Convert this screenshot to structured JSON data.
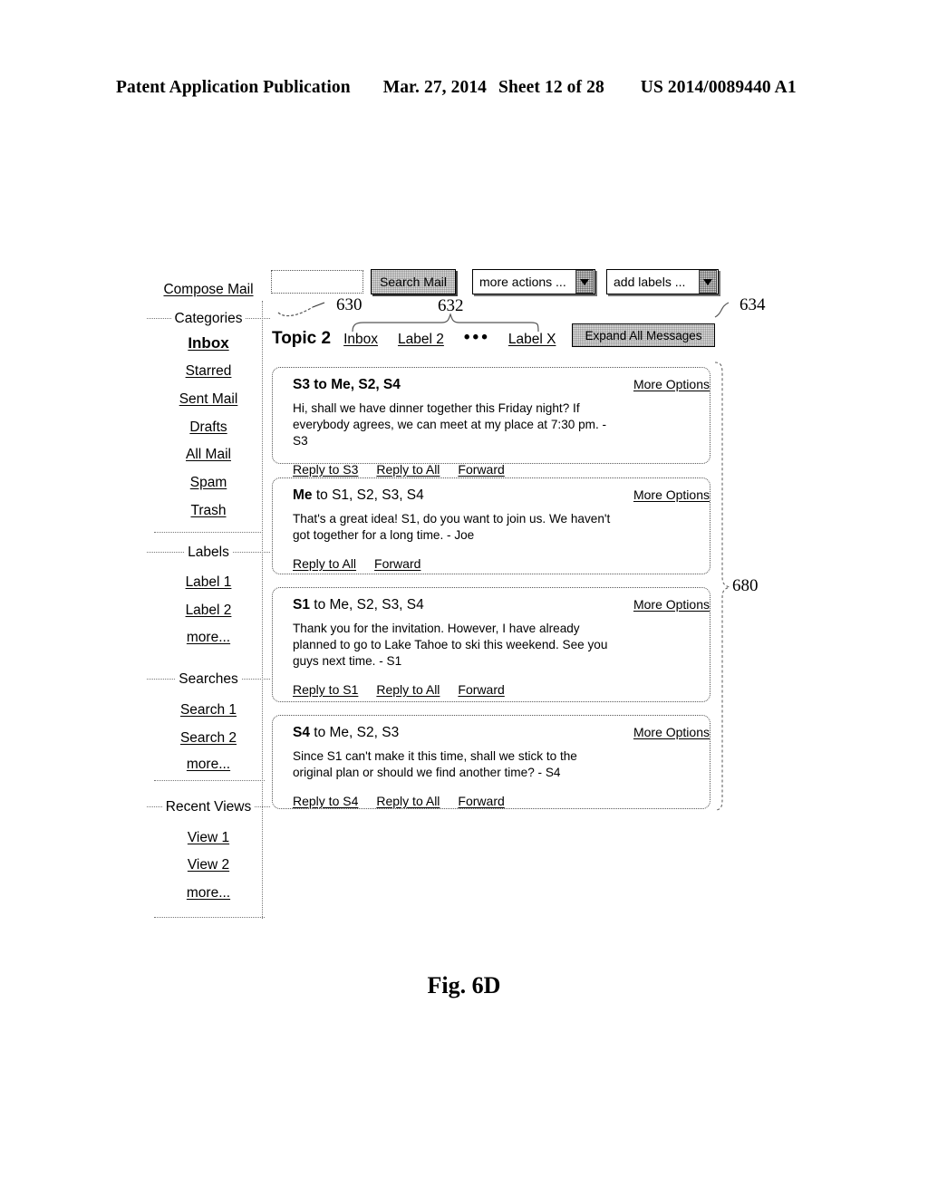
{
  "page": {
    "header": {
      "publication": "Patent Application Publication",
      "date": "Mar. 27, 2014",
      "sheet": "Sheet 12 of 28",
      "patent_number": "US 2014/0089440 A1"
    },
    "figure_caption": "Fig. 6D"
  },
  "sidebar": {
    "compose": "Compose Mail",
    "sections": [
      {
        "label": "Categories",
        "items": [
          {
            "label": "Inbox",
            "selected": true
          },
          {
            "label": "Starred",
            "selected": false
          },
          {
            "label": "Sent Mail",
            "selected": false
          },
          {
            "label": "Drafts",
            "selected": false
          },
          {
            "label": "All Mail",
            "selected": false
          },
          {
            "label": "Spam",
            "selected": false
          },
          {
            "label": "Trash",
            "selected": false
          }
        ]
      },
      {
        "label": "Labels",
        "items": [
          {
            "label": "Label 1",
            "selected": false
          },
          {
            "label": "Label 2",
            "selected": false
          },
          {
            "label": "more...",
            "selected": false
          }
        ]
      },
      {
        "label": "Searches",
        "items": [
          {
            "label": "Search 1",
            "selected": false
          },
          {
            "label": "Search 2",
            "selected": false
          },
          {
            "label": "more...",
            "selected": false
          }
        ]
      },
      {
        "label": "Recent Views",
        "items": [
          {
            "label": "View 1",
            "selected": false
          },
          {
            "label": "View 2",
            "selected": false
          },
          {
            "label": "more...",
            "selected": false
          }
        ]
      }
    ]
  },
  "toolbar": {
    "search_value": "",
    "search_placeholder": "",
    "search_button": "Search Mail",
    "more_actions": "more actions ...",
    "add_labels": "add labels ..."
  },
  "topic": {
    "title": "Topic 2",
    "tabs": [
      "Inbox",
      "Label 2"
    ],
    "ellipsis": "•••",
    "last_tab": "Label X",
    "expand_all_button": "Expand All Messages"
  },
  "messages": [
    {
      "from_prefix": "S3",
      "from_rest": " to Me, S2, S4",
      "prefix_bold": true,
      "rest_bold": true,
      "more_options": "More Options",
      "body": "Hi, shall we have dinner together this Friday night? If everybody agrees, we can meet at my place at 7:30 pm. - S3",
      "actions": [
        "Reply to S3",
        "Reply to All",
        "Forward"
      ]
    },
    {
      "from_prefix": "Me",
      "from_rest": " to S1, S2, S3, S4",
      "prefix_bold": true,
      "rest_bold": false,
      "more_options": "More Options",
      "body": "That's a great idea! S1, do you want to join us. We haven't got together for a long time. - Joe",
      "actions": [
        "Reply to All",
        "Forward"
      ]
    },
    {
      "from_prefix": "S1",
      "from_rest": " to Me, S2, S3, S4",
      "prefix_bold": true,
      "rest_bold": false,
      "more_options": "More Options",
      "body": "Thank you for the invitation. However, I have already planned to go to Lake Tahoe to ski this weekend. See you guys next time. - S1",
      "actions": [
        "Reply to S1",
        "Reply to All",
        "Forward"
      ]
    },
    {
      "from_prefix": "S4",
      "from_rest": " to Me, S2, S3",
      "prefix_bold": true,
      "rest_bold": false,
      "more_options": "More Options",
      "body": "Since S1 can't make it this time, shall we stick to the original plan or should we find another time? - S4",
      "actions": [
        "Reply to S4",
        "Reply to All",
        "Forward"
      ]
    }
  ],
  "reference_numerals": {
    "search_input": "630",
    "topic_tabs": "632",
    "add_labels": "634",
    "message_list": "680"
  }
}
